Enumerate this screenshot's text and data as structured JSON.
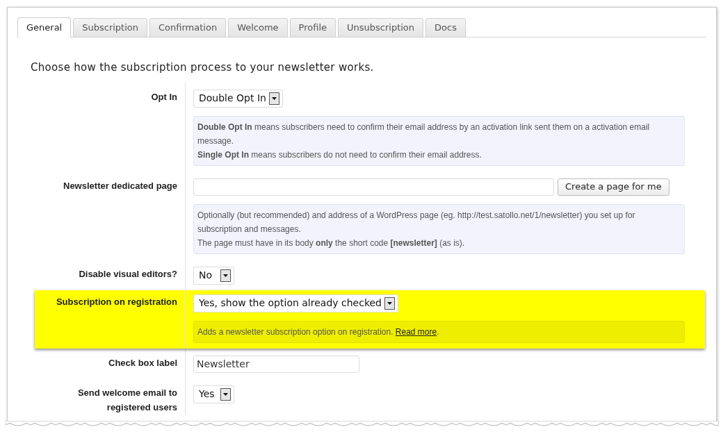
{
  "tabs": [
    {
      "label": "General",
      "selected": true
    },
    {
      "label": "Subscription",
      "selected": false
    },
    {
      "label": "Confirmation",
      "selected": false
    },
    {
      "label": "Welcome",
      "selected": false
    },
    {
      "label": "Profile",
      "selected": false
    },
    {
      "label": "Unsubscription",
      "selected": false
    },
    {
      "label": "Docs",
      "selected": false
    }
  ],
  "intro": "Choose how the subscription process to your newsletter works.",
  "rows": [
    {
      "label": "Opt In",
      "highlighted": false,
      "control": {
        "kind": "select",
        "value": "Double Opt In"
      },
      "help": [
        {
          "text": "**Double Opt In** means subscribers need to confirm their email address by an activation link sent them on a activation email message."
        },
        {
          "text": "**Single Opt In** means subscribers do not need to confirm their email address."
        }
      ]
    },
    {
      "label": "Newsletter dedicated page",
      "highlighted": false,
      "control": {
        "kind": "text"
      },
      "button": "Create a page for me",
      "help": [
        {
          "text": "Optionally (but recommended) and address of a WordPress page (eg. http://test.satollo.net/1/newsletter) you set up for subscription and messages."
        },
        {
          "text": "The page must have in its body **only** the short code **[newsletter]** (as is)."
        }
      ]
    },
    {
      "label": "Disable visual editors?",
      "highlighted": false,
      "control": {
        "kind": "select",
        "value": "No"
      }
    },
    {
      "label": "Subscription on registration",
      "highlighted": true,
      "control": {
        "kind": "select",
        "value": "Yes, show the option already checked"
      },
      "help": [
        {
          "text": "Adds a newsletter subscription option on registration. ",
          "link": "Read more",
          "tail": "."
        }
      ]
    },
    {
      "label": "Check box label",
      "highlighted": false,
      "control": {
        "kind": "text",
        "value": "Newsletter"
      }
    },
    {
      "label": "Send welcome email to registered users",
      "highlighted": false,
      "control": {
        "kind": "select",
        "value": "Yes"
      }
    }
  ]
}
